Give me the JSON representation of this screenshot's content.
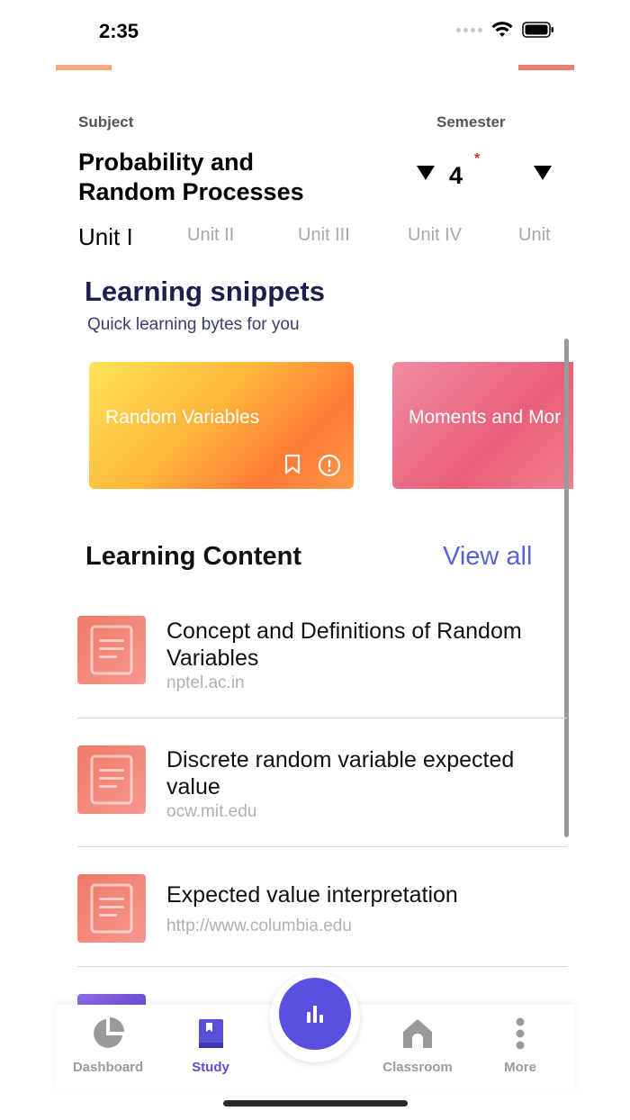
{
  "status_bar": {
    "time": "2:35"
  },
  "header": {
    "subject_label": "Subject",
    "subject_value": "Probability and Random Processes",
    "semester_label": "Semester",
    "semester_value": "4",
    "required_marker": "*"
  },
  "units": {
    "tabs": [
      {
        "label": "Unit I",
        "active": true
      },
      {
        "label": "Unit II",
        "active": false
      },
      {
        "label": "Unit III",
        "active": false
      },
      {
        "label": "Unit IV",
        "active": false
      },
      {
        "label": "Unit",
        "active": false
      }
    ]
  },
  "snippets": {
    "title": "Learning snippets",
    "subtitle": "Quick learning bytes for you",
    "cards": [
      {
        "title": "Random Variables",
        "icons": [
          "bookmark-icon",
          "info-icon"
        ]
      },
      {
        "title": "Moments and Mor"
      }
    ]
  },
  "content": {
    "title": "Learning Content",
    "view_all": "View all",
    "items": [
      {
        "title": "Concept and Definitions of Random Variables",
        "source": "nptel.ac.in",
        "icon": "document-icon"
      },
      {
        "title": "Discrete random variable expected value",
        "source": "ocw.mit.edu",
        "icon": "document-icon"
      },
      {
        "title": "Expected value interpretation",
        "source": "http://www.columbia.edu",
        "icon": "document-icon"
      }
    ]
  },
  "tab_bar": {
    "items": [
      {
        "label": "Dashboard",
        "icon": "pie-chart-icon",
        "active": false
      },
      {
        "label": "Study",
        "icon": "book-icon",
        "active": true
      },
      {
        "label": "",
        "icon": "bar-chart-icon",
        "active": false
      },
      {
        "label": "Classroom",
        "icon": "house-icon",
        "active": false
      },
      {
        "label": "More",
        "icon": "more-vertical-icon",
        "active": false
      }
    ]
  },
  "colors": {
    "accent": "#5a50e0",
    "link": "#5a63d8",
    "title_navy": "#1e1e4e",
    "required": "#e0262b"
  }
}
